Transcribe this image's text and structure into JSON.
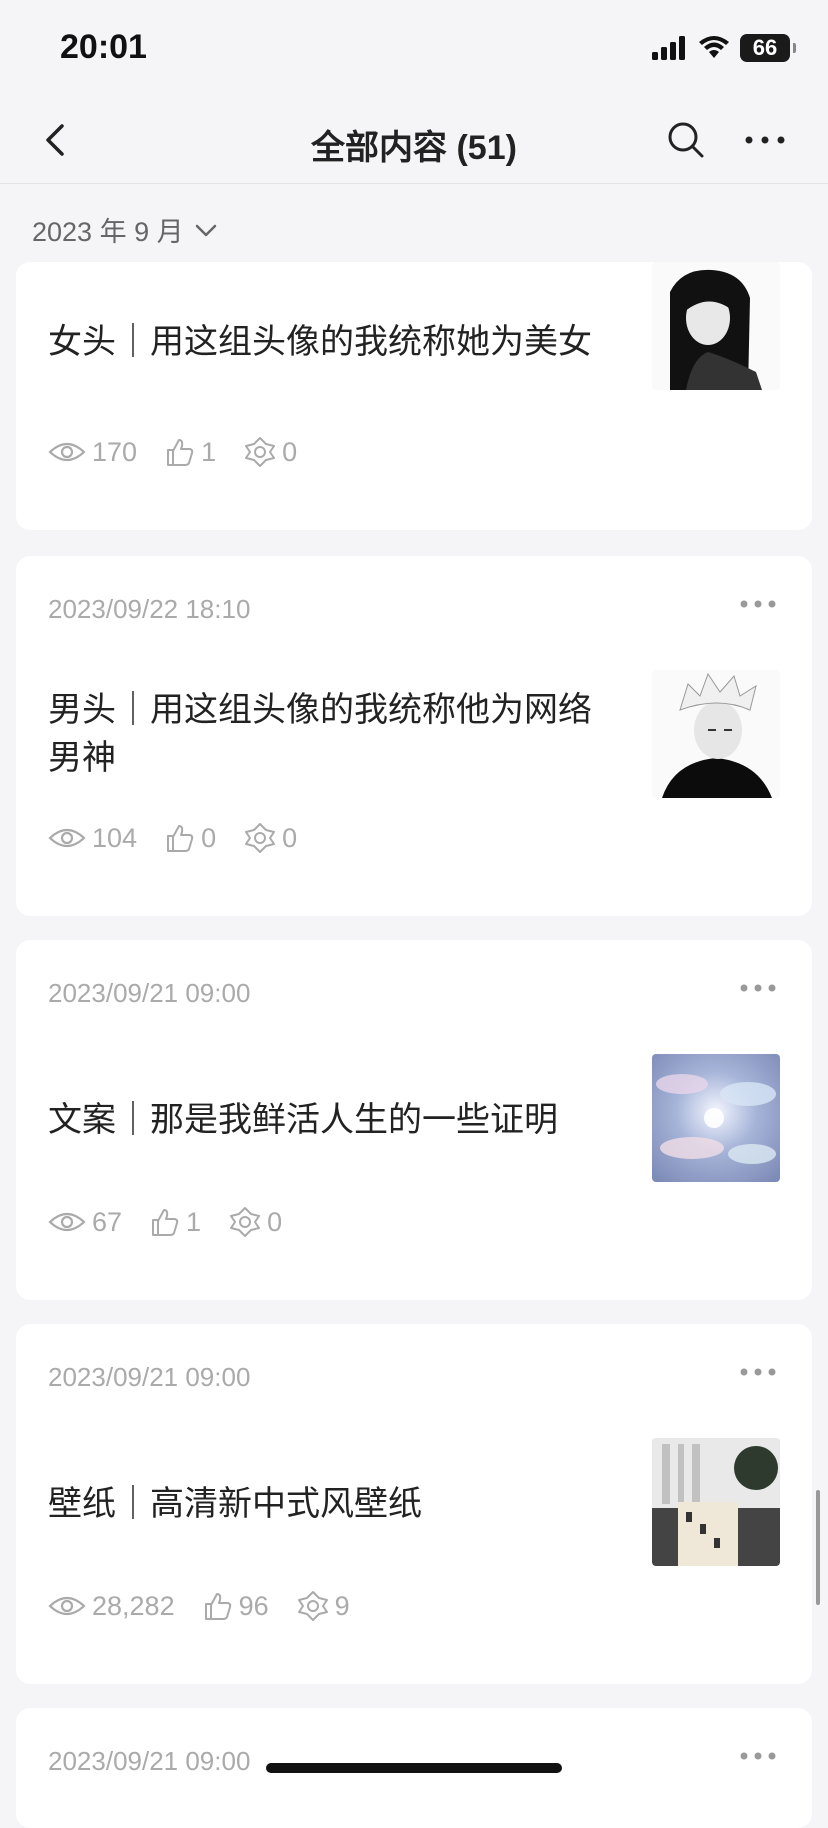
{
  "status": {
    "time": "20:01",
    "battery": "66"
  },
  "nav": {
    "title": "全部内容 (51)"
  },
  "filter": {
    "month": "2023 年 9 月"
  },
  "cards": [
    {
      "date": "",
      "title": "女头｜用这组头像的我统称她为美女",
      "views": "170",
      "likes": "1",
      "shares": "0"
    },
    {
      "date": "2023/09/22 18:10",
      "title": "男头｜用这组头像的我统称他为网络男神",
      "views": "104",
      "likes": "0",
      "shares": "0"
    },
    {
      "date": "2023/09/21 09:00",
      "title": "文案｜那是我鲜活人生的一些证明",
      "views": "67",
      "likes": "1",
      "shares": "0"
    },
    {
      "date": "2023/09/21 09:00",
      "title": "壁纸｜高清新中式风壁纸",
      "views": "28,282",
      "likes": "96",
      "shares": "9"
    },
    {
      "date": "2023/09/21 09:00",
      "title": "",
      "views": "",
      "likes": "",
      "shares": ""
    }
  ],
  "colors": {
    "background": "#f5f5f7",
    "card": "#ffffff",
    "muted": "#aaaaaa",
    "text": "#222222"
  }
}
